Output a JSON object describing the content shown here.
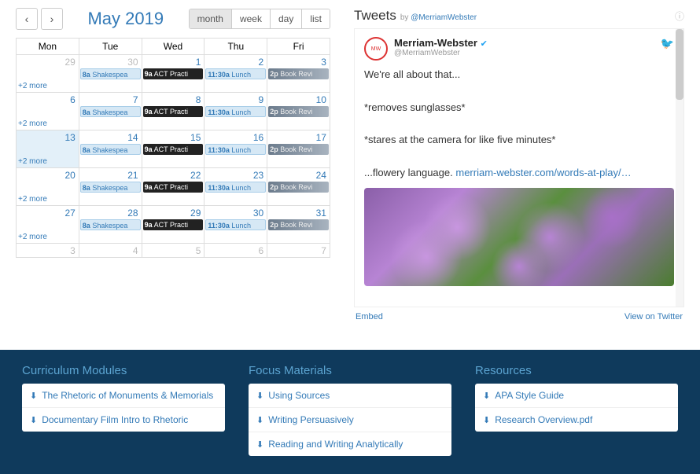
{
  "calendar": {
    "title": "May 2019",
    "views": [
      "month",
      "week",
      "day",
      "list"
    ],
    "active_view": "month",
    "day_headers": [
      "Mon",
      "Tue",
      "Wed",
      "Thu",
      "Fri"
    ],
    "more_label": "+2 more",
    "events": {
      "shakespeare": {
        "time": "8a",
        "label": "Shakespea"
      },
      "act": {
        "time": "9a",
        "label": "ACT Practi"
      },
      "lunch": {
        "time": "11:30a",
        "label": "Lunch"
      },
      "book": {
        "time": "2p",
        "label": "Book Revi"
      }
    },
    "weeks": [
      {
        "days": [
          29,
          30,
          1,
          2,
          3
        ],
        "muted": [
          true,
          true,
          false,
          false,
          false
        ],
        "today": null
      },
      {
        "days": [
          6,
          7,
          8,
          9,
          10
        ],
        "muted": [
          false,
          false,
          false,
          false,
          false
        ],
        "today": null
      },
      {
        "days": [
          13,
          14,
          15,
          16,
          17
        ],
        "muted": [
          false,
          false,
          false,
          false,
          false
        ],
        "today": 0
      },
      {
        "days": [
          20,
          21,
          22,
          23,
          24
        ],
        "muted": [
          false,
          false,
          false,
          false,
          false
        ],
        "today": null
      },
      {
        "days": [
          27,
          28,
          29,
          30,
          31
        ],
        "muted": [
          false,
          false,
          false,
          false,
          false
        ],
        "today": null
      },
      {
        "days": [
          3,
          4,
          5,
          6,
          7
        ],
        "muted": [
          true,
          true,
          true,
          true,
          true
        ],
        "today": null
      }
    ]
  },
  "tweets": {
    "title": "Tweets",
    "by_prefix": "by ",
    "by_handle": "@MerriamWebster",
    "author_name": "Merriam-Webster",
    "author_handle": "@MerriamWebster",
    "body_line1": "We're all about that...",
    "body_line2": "*removes sunglasses*",
    "body_line3": "*stares at the camera for like five minutes*",
    "body_line4_pre": "...flowery language. ",
    "body_link": "merriam-webster.com/words-at-play/…",
    "embed": "Embed",
    "view_on": "View on Twitter"
  },
  "bottom": {
    "col1_title": "Curriculum Modules",
    "col1_items": [
      "The Rhetoric of Monuments & Memorials",
      "Documentary Film Intro to Rhetoric"
    ],
    "col2_title": "Focus Materials",
    "col2_items": [
      "Using Sources",
      "Writing Persuasively",
      "Reading and Writing Analytically"
    ],
    "col3_title": "Resources",
    "col3_items": [
      "APA Style Guide",
      "Research Overview.pdf"
    ]
  }
}
